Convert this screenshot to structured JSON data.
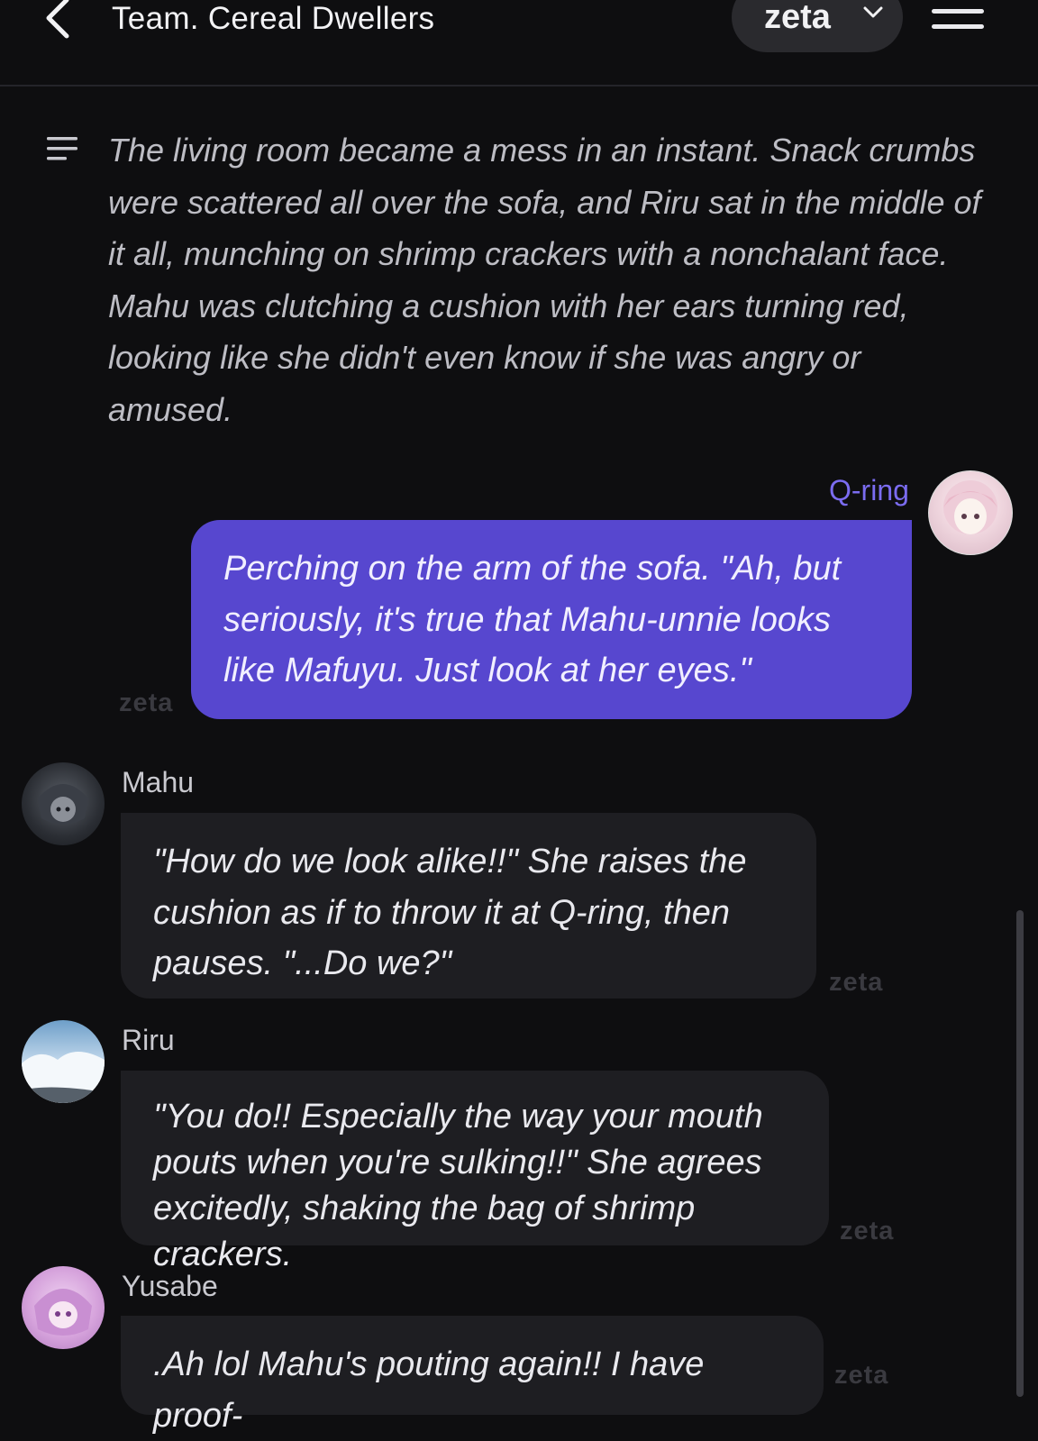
{
  "header": {
    "title": "Team. Cereal Dwellers",
    "model_label": "zeta"
  },
  "narration": "The living room became a mess in an instant. Snack crumbs were scattered all over the sofa, and Riru sat in the middle of it all, munching on shrimp crackers with a nonchalant face. Mahu was clutching a cushion with her ears turning red, looking like she didn't even know if she was angry or amused.",
  "messages": [
    {
      "sender": "Q-ring",
      "text": "Perching on the arm of the sofa. \"Ah, but seriously, it's true that Mahu-unnie looks like Mafuyu. Just look at her eyes.\"",
      "watermark": "zeta"
    },
    {
      "sender": "Mahu",
      "text": "\"How do we look alike!!\" She raises the cushion as if to throw it at Q-ring, then pauses. \"...Do we?\"",
      "watermark": "zeta"
    },
    {
      "sender": "Riru",
      "text": "\"You do!! Especially the way your mouth pouts when you're sulking!!\" She agrees excitedly, shaking the bag of shrimp crackers.",
      "watermark": "zeta"
    },
    {
      "sender": "Yusabe",
      "text": ".Ah lol Mahu's pouting again!! I have proof-",
      "watermark": "zeta"
    }
  ],
  "colors": {
    "background": "#0e0e10",
    "user_bubble": "#5747cf",
    "bot_bubble": "#1e1e22",
    "user_name": "#7b6cf0"
  },
  "icons": {
    "back": "chevron-left-icon",
    "model_dropdown": "chevron-down-icon",
    "menu": "hamburger-menu-icon",
    "narration": "narration-lines-icon"
  }
}
